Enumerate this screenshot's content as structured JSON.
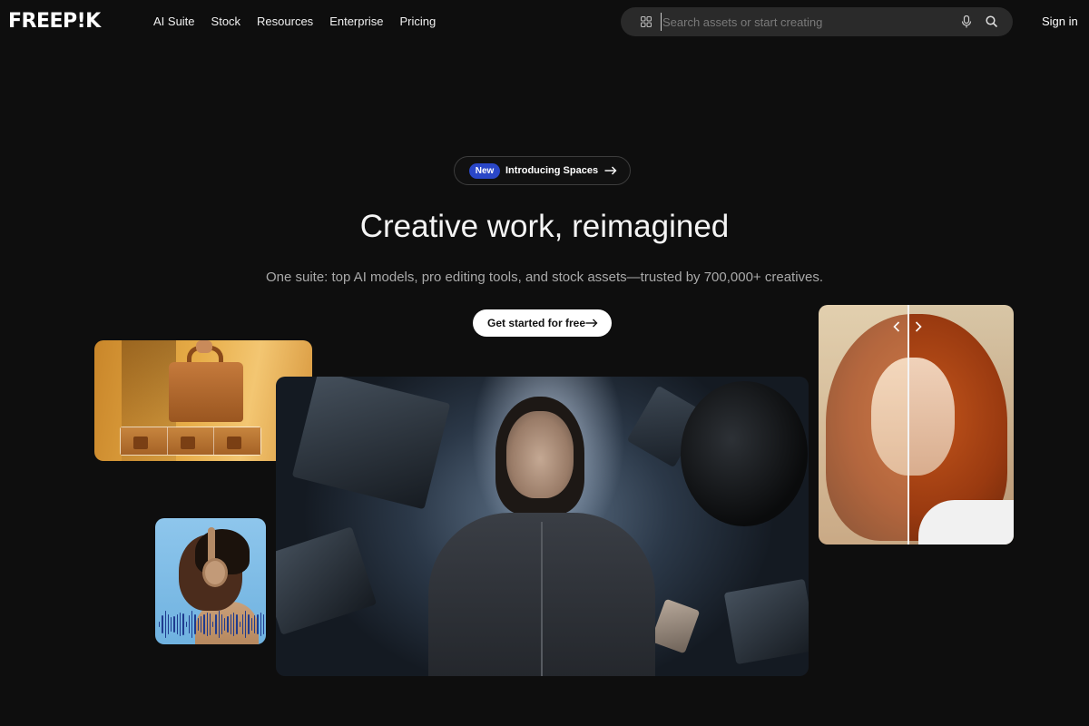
{
  "header": {
    "logo": "FREEP!K",
    "nav": [
      {
        "label": "AI Suite"
      },
      {
        "label": "Stock"
      },
      {
        "label": "Resources"
      },
      {
        "label": "Enterprise"
      },
      {
        "label": "Pricing"
      }
    ],
    "search": {
      "placeholder": "Search assets or start creating",
      "value": "",
      "left_icon": "grid-icon",
      "mic_icon": "microphone-icon",
      "search_icon": "search-icon"
    },
    "sign_in": "Sign in"
  },
  "hero": {
    "pill_badge": "New",
    "pill_label": "Introducing Spaces",
    "headline": "Creative work, reimagined",
    "subline": "One suite: top AI models, pro editing tools, and stock assets—trusted by 700,000+ creatives.",
    "cta_label": "Get started for free"
  },
  "media": {
    "left_card": "bag-product-photo",
    "center_card": "woman-in-space-video",
    "audio_card": "man-with-headphones",
    "right_card": "portrait-compare"
  },
  "colors": {
    "background": "#0e0e0e",
    "badge": "#2a47c7",
    "cta_bg": "#ffffff",
    "search_bg": "#2a2a2a"
  }
}
